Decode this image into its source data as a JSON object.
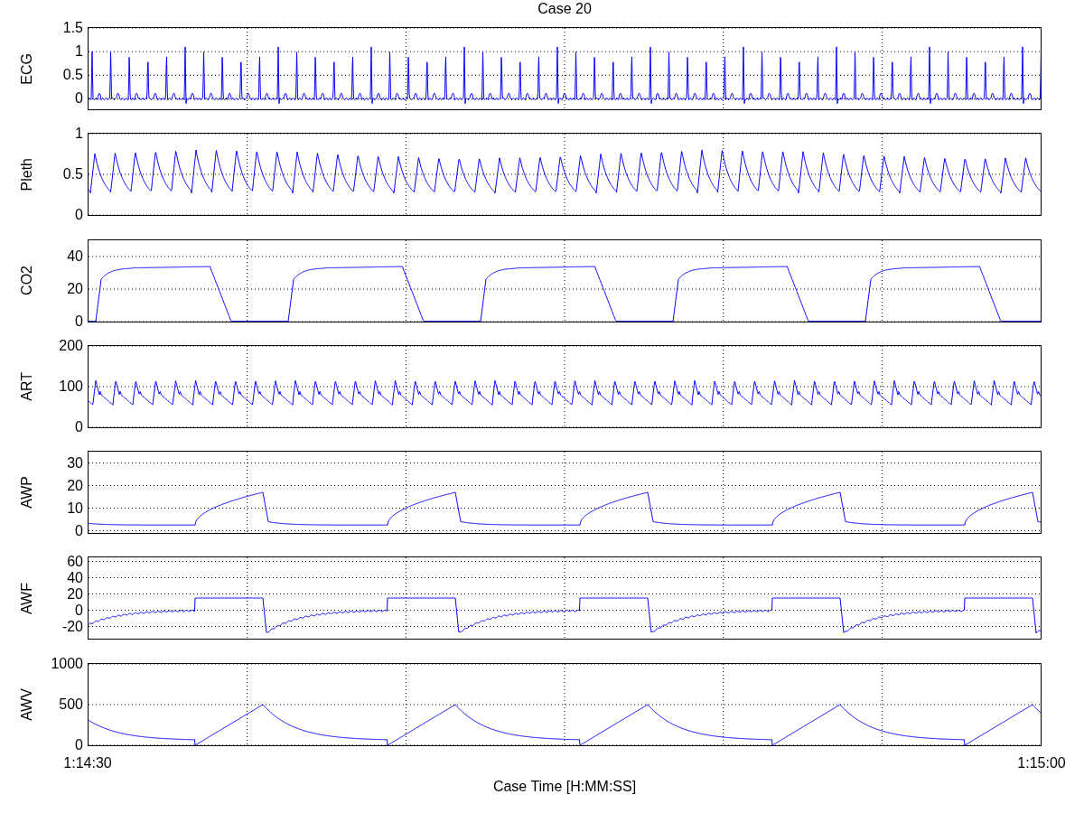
{
  "title": "Case 20",
  "panels": [
    {
      "kind": "ecg",
      "label": "ECG",
      "yticks": [
        "1.5",
        "1",
        "0.5",
        "0"
      ]
    },
    {
      "kind": "pleth",
      "label": "Pleth",
      "yticks": [
        "1",
        "0.5",
        "0"
      ]
    },
    {
      "kind": "co2",
      "label": "CO2",
      "yticks": [
        "40",
        "20",
        "0"
      ]
    },
    {
      "kind": "art",
      "label": "ART",
      "yticks": [
        "200",
        "100",
        "0"
      ]
    },
    {
      "kind": "awp",
      "label": "AWP",
      "yticks": [
        "30",
        "20",
        "10",
        "0"
      ]
    },
    {
      "kind": "awf",
      "label": "AWF",
      "yticks": [
        "60",
        "40",
        "20",
        "0",
        "-20"
      ]
    },
    {
      "kind": "awv",
      "label": "AWV",
      "yticks": [
        "1000",
        "500",
        "0"
      ]
    }
  ],
  "xticks": [
    "1:14:30",
    "1:15:00"
  ],
  "xlabel": "Case Time [H:MM:SS]"
}
